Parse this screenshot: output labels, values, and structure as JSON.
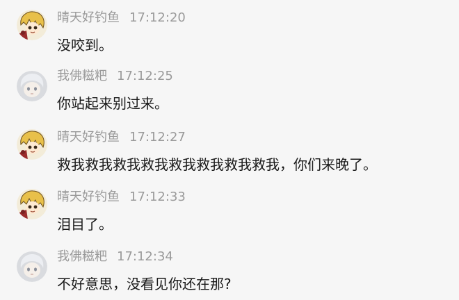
{
  "messages": [
    {
      "sender": "晴天好钓鱼",
      "time": "17:12:20",
      "text": "没咬到。",
      "avatar": "blonde-character-avatar"
    },
    {
      "sender": "我佛糍粑",
      "time": "17:12:25",
      "text": "你站起来别过来。",
      "avatar": "pale-character-avatar"
    },
    {
      "sender": "晴天好钓鱼",
      "time": "17:12:27",
      "text": "救我救我救我救我救我救我救我救我，你们来晚了。",
      "avatar": "blonde-character-avatar"
    },
    {
      "sender": "晴天好钓鱼",
      "time": "17:12:33",
      "text": "泪目了。",
      "avatar": "blonde-character-avatar"
    },
    {
      "sender": "我佛糍粑",
      "time": "17:12:34",
      "text": "不好意思，没看见你还在那?",
      "avatar": "pale-character-avatar"
    }
  ],
  "colors": {
    "background": "#f6f6f6",
    "meta_text": "#9a9a9a",
    "body_text": "#1a1a1a"
  }
}
